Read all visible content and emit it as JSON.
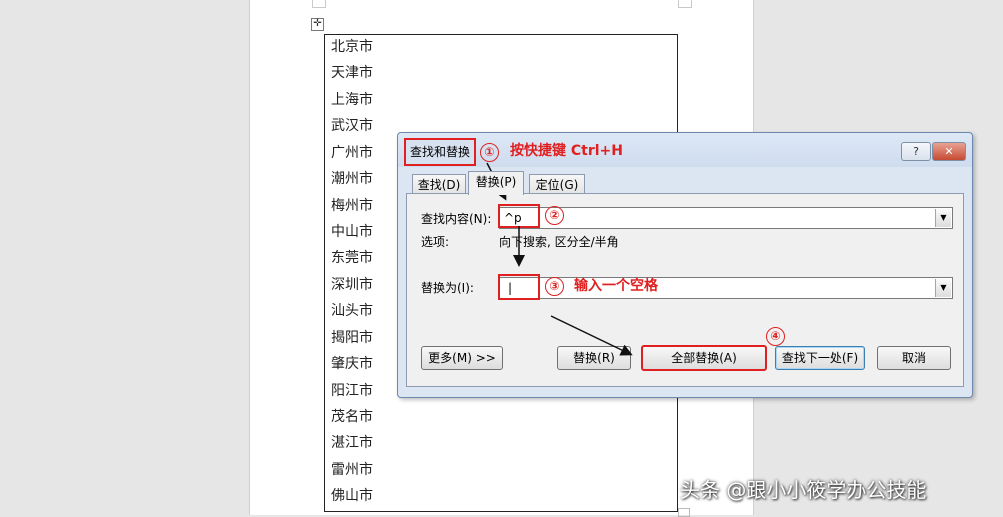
{
  "document": {
    "cities": [
      "北京市",
      "天津市",
      "上海市",
      "武汉市",
      "广州市",
      "潮州市",
      "梅州市",
      "中山市",
      "东莞市",
      "深圳市",
      "汕头市",
      "揭阳市",
      "肇庆市",
      "阳江市",
      "茂名市",
      "湛江市",
      "雷州市",
      "佛山市"
    ]
  },
  "dialog": {
    "title": "查找和替换",
    "help_label": "?",
    "close_label": "✕",
    "tabs": [
      {
        "label": "查找(D)",
        "active": false
      },
      {
        "label": "替换(P)",
        "active": true
      },
      {
        "label": "定位(G)",
        "active": false
      }
    ],
    "find_label": "查找内容(N):",
    "find_value": "^p",
    "options_label": "选项:",
    "options_value": "向下搜索, 区分全/半角",
    "replace_label": "替换为(I):",
    "replace_value": "|",
    "dropdown_glyph": "▼",
    "buttons": {
      "more": "更多(M) >>",
      "replace": "替换(R)",
      "replace_all": "全部替换(A)",
      "find_next": "查找下一处(F)",
      "cancel": "取消"
    }
  },
  "annotations": {
    "step1_num": "①",
    "step1_text": "按快捷键 Ctrl+H",
    "step2_num": "②",
    "step3_num": "③",
    "step3_text": "输入一个空格",
    "step4_num": "④",
    "color": "#e02020"
  },
  "watermark": "头条 @跟小小筱学办公技能",
  "icons": {
    "table_move": "move-icon"
  }
}
